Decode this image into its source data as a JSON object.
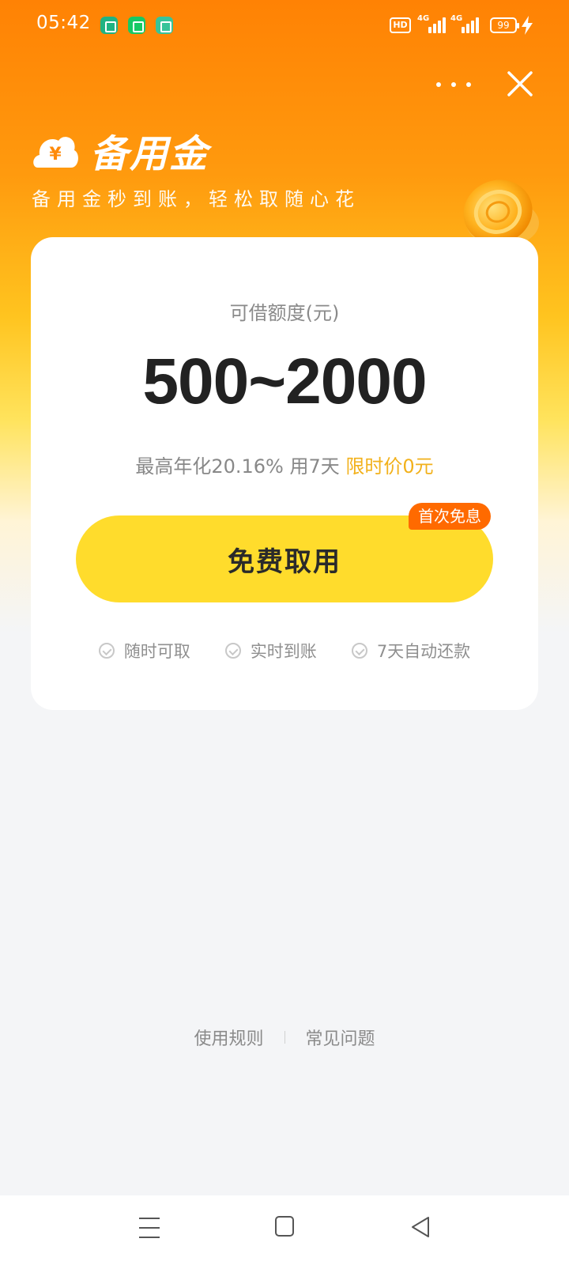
{
  "status_bar": {
    "time": "05:42",
    "hd_label": "HD",
    "network_1": "4G",
    "network_2": "4G",
    "battery_level": "99"
  },
  "header": {
    "brand_title": "备用金",
    "slogan": "备用金秒到账，轻松取随心花",
    "logo_symbol": "¥"
  },
  "card": {
    "label": "可借额度(元)",
    "amount": "500~2000",
    "rate_text": "最高年化20.16% 用7天",
    "promo_text": "限时价0元",
    "cta_label": "免费取用",
    "cta_badge": "首次免息",
    "features": [
      {
        "label": "随时可取"
      },
      {
        "label": "实时到账"
      },
      {
        "label": "7天自动还款"
      }
    ]
  },
  "footer": {
    "rules_link": "使用规则",
    "faq_link": "常见问题"
  },
  "colors": {
    "accent_orange": "#ff8204",
    "cta_yellow": "#ffdc2c",
    "badge_orange": "#ff6a00",
    "promo_gold": "#f2b11b"
  }
}
